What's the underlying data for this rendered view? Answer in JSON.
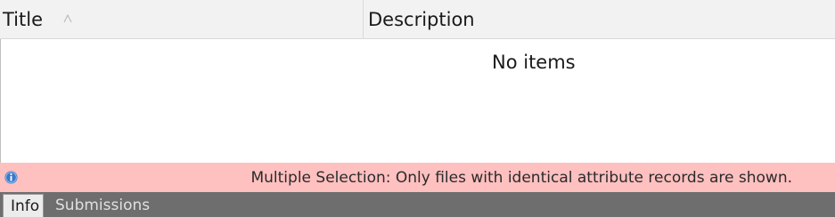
{
  "table": {
    "columns": [
      {
        "label": "Title",
        "sort": "ascending"
      },
      {
        "label": "Description"
      }
    ],
    "empty_text": "No items"
  },
  "banner": {
    "icon": "info-icon",
    "text": "Multiple Selection: Only files with identical attribute records are shown.",
    "background_color": "#ffc0c0"
  },
  "tabs": [
    {
      "label": "Info",
      "active": true
    },
    {
      "label": "Submissions",
      "active": false
    }
  ],
  "colors": {
    "header_bg": "#f2f2f2",
    "tabbar_bg": "#6e6e6e",
    "info_icon": "#3a78c9"
  }
}
